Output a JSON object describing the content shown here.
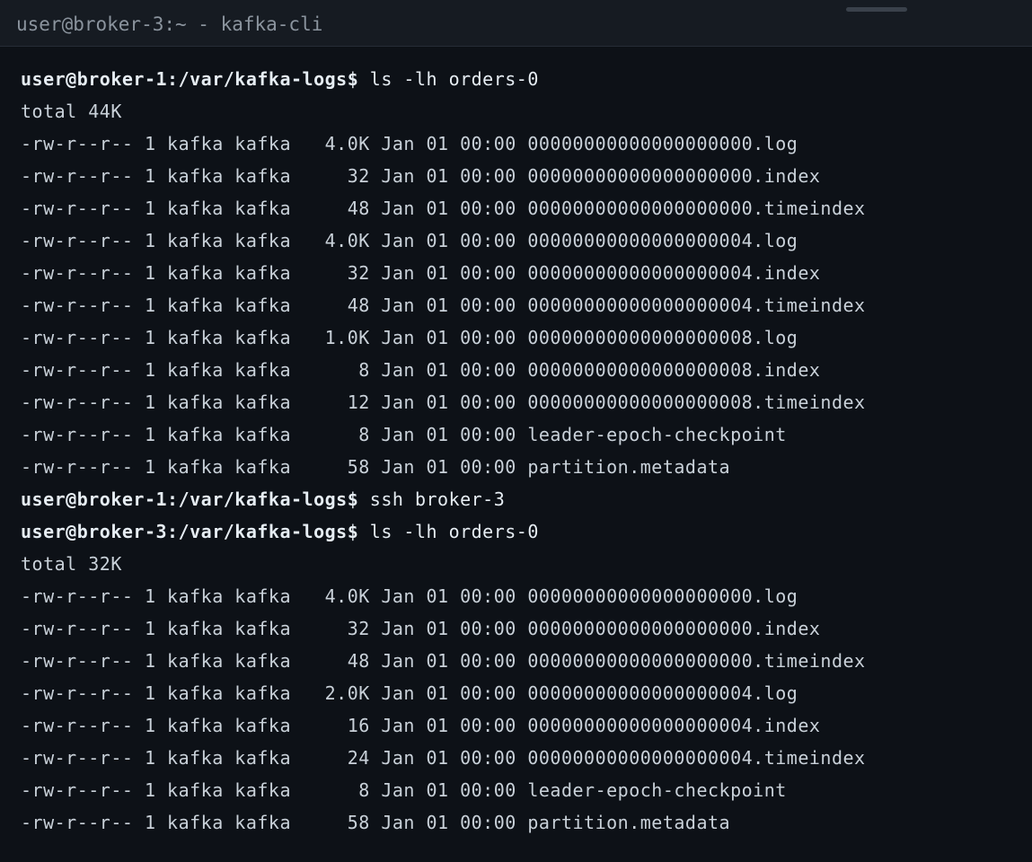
{
  "window": {
    "title": "user@broker-3:~ - kafka-cli"
  },
  "terminal": {
    "lines": [
      {
        "type": "prompt",
        "prompt": "user@broker-1:/var/kafka-logs$",
        "command": " ls -lh orders-0"
      },
      {
        "type": "output",
        "text": "total 44K"
      },
      {
        "type": "output",
        "text": "-rw-r--r-- 1 kafka kafka   4.0K Jan 01 00:00 00000000000000000000.log"
      },
      {
        "type": "output",
        "text": "-rw-r--r-- 1 kafka kafka     32 Jan 01 00:00 00000000000000000000.index"
      },
      {
        "type": "output",
        "text": "-rw-r--r-- 1 kafka kafka     48 Jan 01 00:00 00000000000000000000.timeindex"
      },
      {
        "type": "output",
        "text": "-rw-r--r-- 1 kafka kafka   4.0K Jan 01 00:00 00000000000000000004.log"
      },
      {
        "type": "output",
        "text": "-rw-r--r-- 1 kafka kafka     32 Jan 01 00:00 00000000000000000004.index"
      },
      {
        "type": "output",
        "text": "-rw-r--r-- 1 kafka kafka     48 Jan 01 00:00 00000000000000000004.timeindex"
      },
      {
        "type": "output",
        "text": "-rw-r--r-- 1 kafka kafka   1.0K Jan 01 00:00 00000000000000000008.log"
      },
      {
        "type": "output",
        "text": "-rw-r--r-- 1 kafka kafka      8 Jan 01 00:00 00000000000000000008.index"
      },
      {
        "type": "output",
        "text": "-rw-r--r-- 1 kafka kafka     12 Jan 01 00:00 00000000000000000008.timeindex"
      },
      {
        "type": "output",
        "text": "-rw-r--r-- 1 kafka kafka      8 Jan 01 00:00 leader-epoch-checkpoint"
      },
      {
        "type": "output",
        "text": "-rw-r--r-- 1 kafka kafka     58 Jan 01 00:00 partition.metadata"
      },
      {
        "type": "prompt",
        "prompt": "user@broker-1:/var/kafka-logs$",
        "command": " ssh broker-3"
      },
      {
        "type": "prompt",
        "prompt": "user@broker-3:/var/kafka-logs$",
        "command": " ls -lh orders-0"
      },
      {
        "type": "output",
        "text": "total 32K"
      },
      {
        "type": "output",
        "text": "-rw-r--r-- 1 kafka kafka   4.0K Jan 01 00:00 00000000000000000000.log"
      },
      {
        "type": "output",
        "text": "-rw-r--r-- 1 kafka kafka     32 Jan 01 00:00 00000000000000000000.index"
      },
      {
        "type": "output",
        "text": "-rw-r--r-- 1 kafka kafka     48 Jan 01 00:00 00000000000000000000.timeindex"
      },
      {
        "type": "output",
        "text": "-rw-r--r-- 1 kafka kafka   2.0K Jan 01 00:00 00000000000000000004.log"
      },
      {
        "type": "output",
        "text": "-rw-r--r-- 1 kafka kafka     16 Jan 01 00:00 00000000000000000004.index"
      },
      {
        "type": "output",
        "text": "-rw-r--r-- 1 kafka kafka     24 Jan 01 00:00 00000000000000000004.timeindex"
      },
      {
        "type": "output",
        "text": "-rw-r--r-- 1 kafka kafka      8 Jan 01 00:00 leader-epoch-checkpoint"
      },
      {
        "type": "output",
        "text": "-rw-r--r-- 1 kafka kafka     58 Jan 01 00:00 partition.metadata"
      }
    ]
  },
  "colors": {
    "background": "#0d1117",
    "titlebar": "#161b22",
    "text": "#c9d1d9",
    "prompt": "#e6edf3",
    "title_text": "#8b949e"
  }
}
